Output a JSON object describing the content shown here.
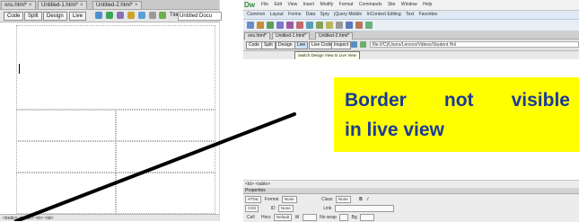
{
  "left_window": {
    "tabs": [
      {
        "label": "ons.html*",
        "close": "×"
      },
      {
        "label": "Untitled-1.html*",
        "close": "×"
      },
      {
        "label": "Untitled-2.html*",
        "close": "×"
      }
    ],
    "view_buttons": {
      "code": "Code",
      "split": "Split",
      "design": "Design",
      "live": "Live"
    },
    "title_label": "Title:",
    "title_value": "Untitled Docu",
    "status_path": "<body> <table> <tr> <td>"
  },
  "top_right": {
    "app_logo": "Dw",
    "menu": [
      "File",
      "Edit",
      "View",
      "Insert",
      "Modify",
      "Format",
      "Commands",
      "Site",
      "Window",
      "Help"
    ],
    "insert_tabs": [
      "Common",
      "Layout",
      "Forms",
      "Data",
      "Spry",
      "jQuery Mobile",
      "InContext Editing",
      "Text",
      "Favorites"
    ],
    "doc_tabs": [
      "ons.html*",
      "Untitled-1.html*",
      "Untitled-2.html*"
    ],
    "view_buttons": {
      "code": "Code",
      "split": "Split",
      "design": "Design",
      "live": "Live",
      "live_code": "Live Code",
      "inspect": "Inspect"
    },
    "path": "file:///C|/Users/Lenovo/Videos/Student Hol",
    "tooltip": "Switch Design View to Live View"
  },
  "note": {
    "line1_words": [
      "Border",
      "not",
      "visible"
    ],
    "line2": "in live view",
    "bg": "#ffff00",
    "text_color": "#1a3a9a"
  },
  "bottom_right": {
    "crumb": "<td> <table>",
    "properties_label": "Properties",
    "row1": {
      "html": "HTML",
      "format": "Format",
      "format_val": "None",
      "class": "Class",
      "class_val": "None"
    },
    "row2": {
      "css": "CSS",
      "id": "ID",
      "id_val": "None",
      "link": "Link"
    },
    "row3": {
      "cell": "Cell",
      "horz": "Horz",
      "horz_val": "Default",
      "w": "W",
      "nowrap": "No wrap",
      "bg": "Bg"
    }
  }
}
